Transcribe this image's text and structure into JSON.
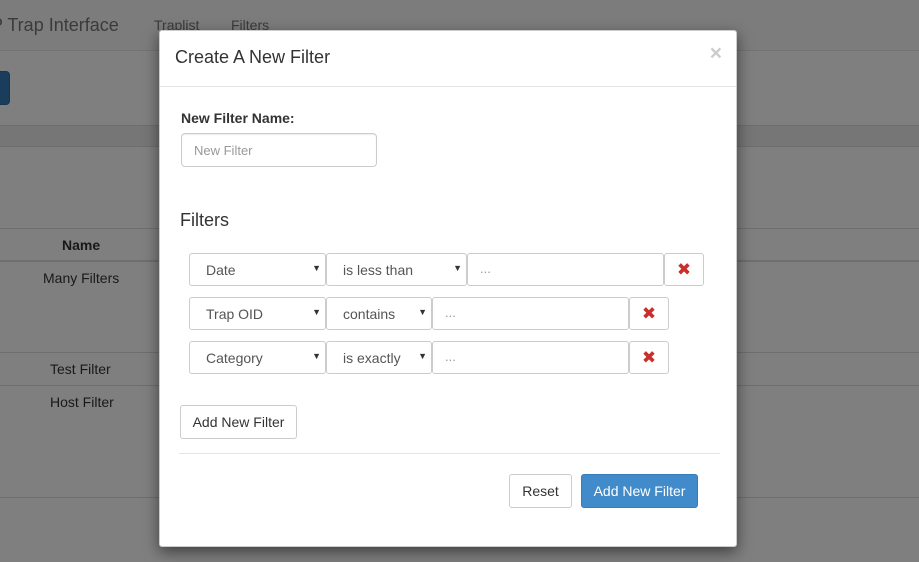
{
  "background": {
    "brand": "P Trap Interface",
    "nav": [
      "Traplist",
      "Filters"
    ],
    "table": {
      "header_name": "Name",
      "rows": [
        "Many Filters",
        "Test Filter",
        "Host Filter"
      ]
    }
  },
  "modal": {
    "title": "Create A New Filter",
    "close_symbol": "×",
    "name_label": "New Filter Name:",
    "name_placeholder": "New Filter",
    "filters_heading": "Filters",
    "filter_rows": [
      {
        "field": "Date",
        "operator": "is less than",
        "value_placeholder": "..."
      },
      {
        "field": "Trap OID",
        "operator": "contains",
        "value_placeholder": "..."
      },
      {
        "field": "Category",
        "operator": "is exactly",
        "value_placeholder": "..."
      }
    ],
    "remove_symbol": "✖",
    "caret_symbol": "▼",
    "add_filter_label": "Add New Filter",
    "reset_label": "Reset",
    "submit_label": "Add New Filter"
  },
  "colors": {
    "primary": "#428bca",
    "remove_icon": "#c9302c"
  }
}
